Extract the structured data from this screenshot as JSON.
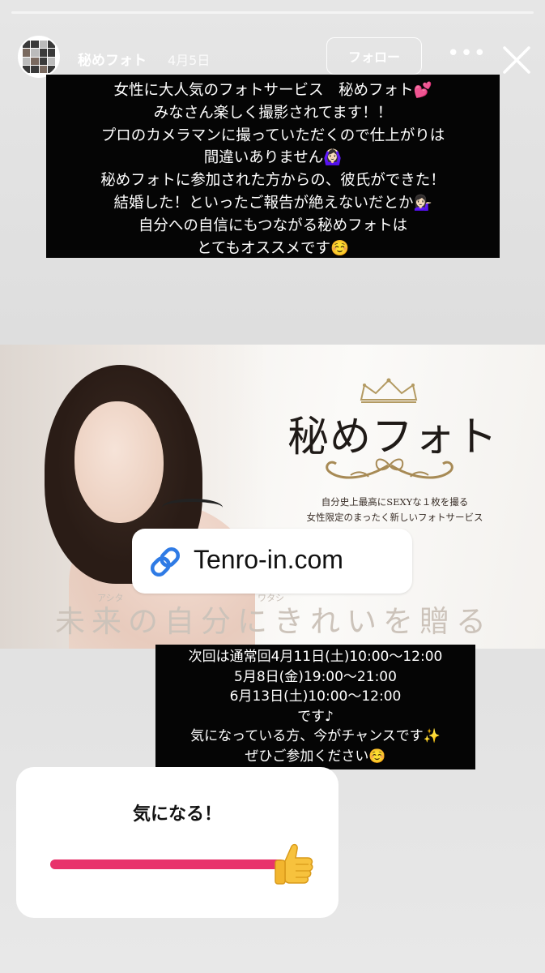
{
  "story": {
    "progress": 0.0
  },
  "header": {
    "username": "秘めフォト",
    "date": "4月5日",
    "follow_label": "フォロー",
    "more_glyph": "•••",
    "icons": [
      "avatar",
      "more-icon",
      "close-icon"
    ]
  },
  "caption_top": {
    "lines": [
      "女性に大人気のフォトサービス　秘めフォト💕",
      "みなさん楽しく撮影されてます！！",
      "プロのカメラマンに撮っていただくので仕上がりは",
      "間違いありません🙆🏻‍♀️",
      "秘めフォトに参加された方からの、彼氏ができた！",
      "結婚した！といったご報告が絶えないだとか💁🏻‍♀️",
      "自分への自信にもつながる秘めフォトは",
      "とてもオススメです☺️"
    ]
  },
  "banner": {
    "brand_title": "秘めフォト",
    "tagline_1": "自分史上最高にSEXYな１枚を撮る",
    "tagline_2": "女性限定のまったく新しいフォトサービス",
    "ruby_1": "アシタ",
    "ruby_2": "ワタシ",
    "slogan": "未来の自分にきれいを贈る"
  },
  "link_sticker": {
    "text": "Tenro-in.com",
    "icon": "link-icon"
  },
  "caption_bottom": {
    "lines": [
      "次回は通常回4月11日(土)10:00〜12:00",
      "5月8日(金)19:00〜21:00",
      "6月13日(土)10:00〜12:00",
      "です♪",
      "気になっている方、今がチャンスです✨",
      "ぜひご参加ください☺️"
    ]
  },
  "slider_sticker": {
    "question": "気になる！",
    "value_fraction": 1.0,
    "emoji": "👍",
    "fill_color": "#e8336b"
  }
}
